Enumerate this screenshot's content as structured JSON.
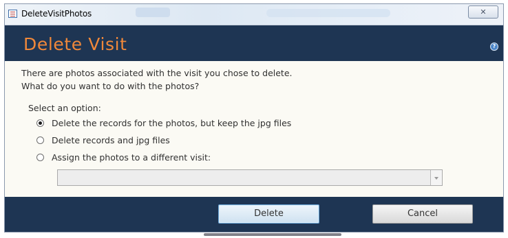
{
  "window": {
    "title": "DeleteVisitPhotos",
    "close_glyph": "✕"
  },
  "header": {
    "title": "Delete Visit",
    "help_glyph": "?"
  },
  "message": {
    "line1": "There are photos associated with the visit you chose to delete.",
    "line2": "What do you want to do with the photos?"
  },
  "options": {
    "label": "Select an option:",
    "items": [
      {
        "label": "Delete the records for the photos, but keep the jpg files",
        "selected": true
      },
      {
        "label": "Delete records and jpg files",
        "selected": false
      },
      {
        "label": "Assign the photos to a different visit:",
        "selected": false
      }
    ]
  },
  "visit_select": {
    "value": ""
  },
  "buttons": {
    "delete": "Delete",
    "cancel": "Cancel"
  },
  "colors": {
    "header_bg": "#1e3553",
    "title_accent": "#f0883a",
    "body_bg": "#fbfaf4"
  },
  "icons": {
    "app": "access-form-icon",
    "help": "help-icon",
    "close": "close-icon"
  }
}
